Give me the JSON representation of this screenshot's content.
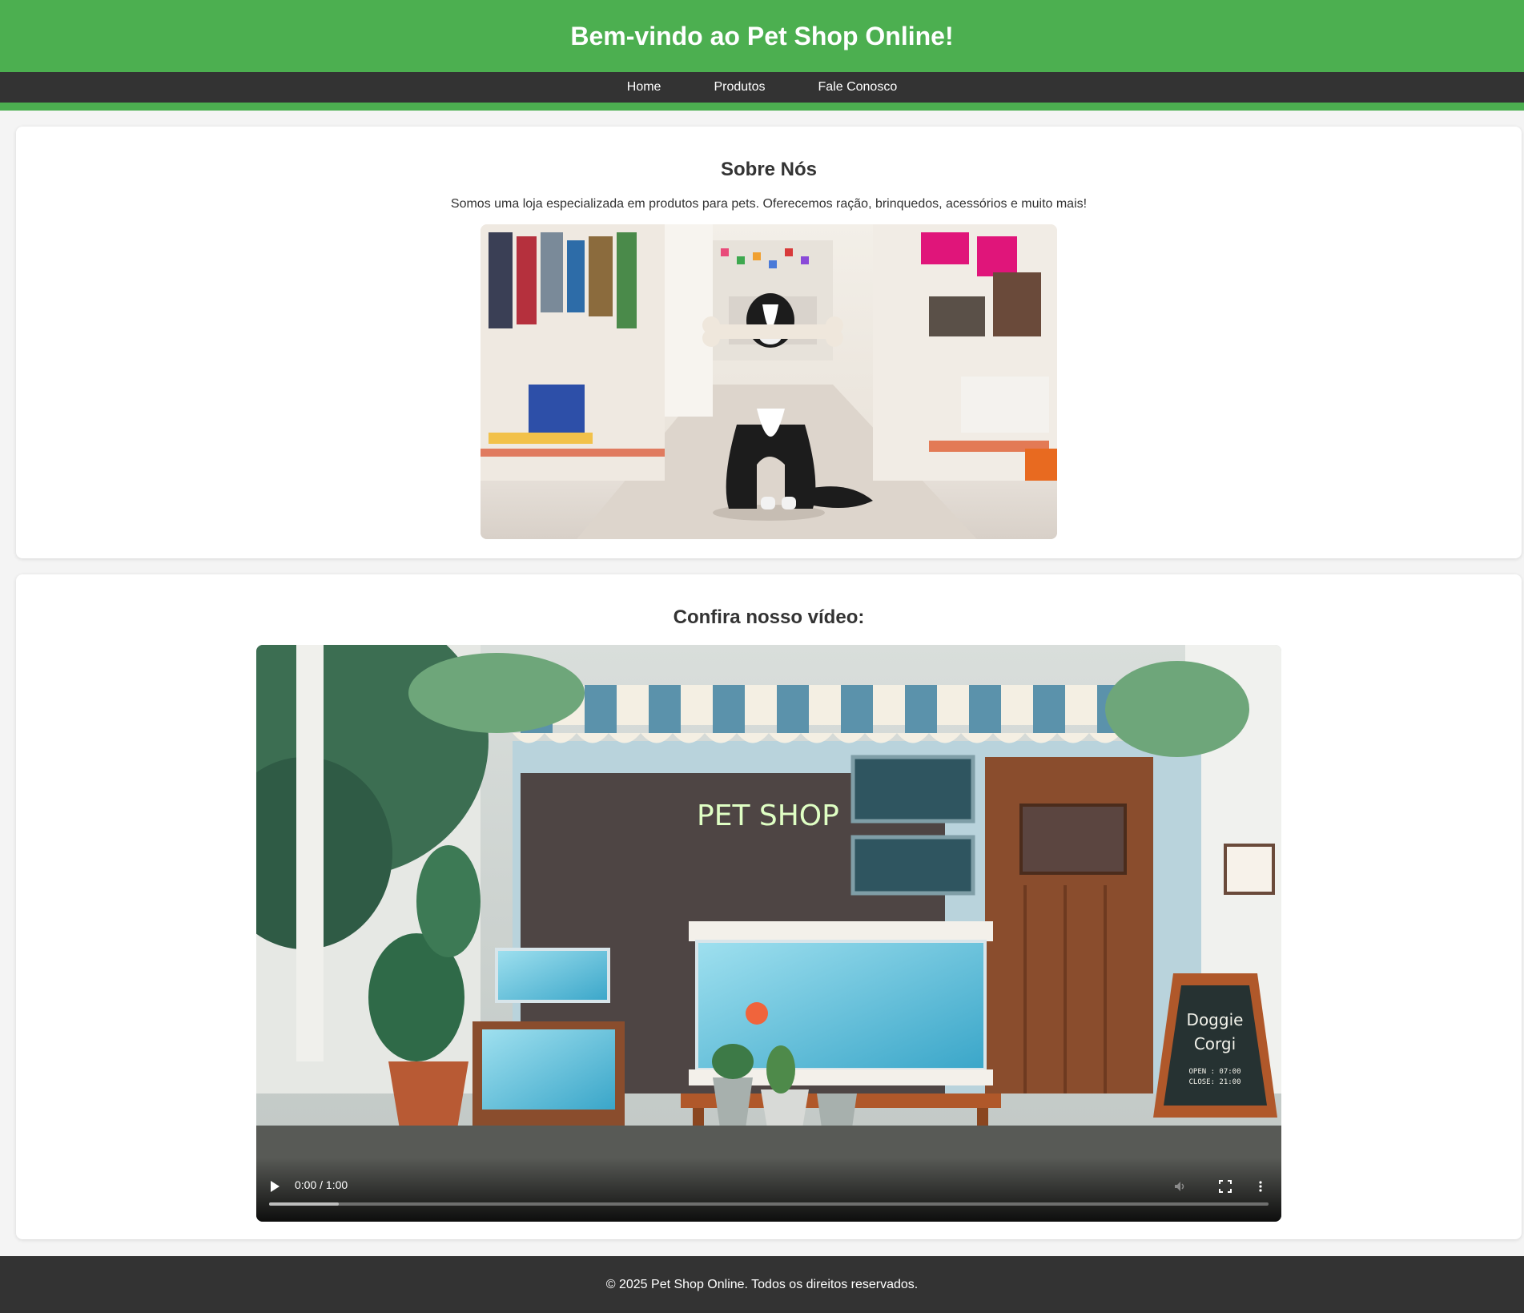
{
  "header": {
    "title": "Bem-vindo ao Pet Shop Online!"
  },
  "nav": {
    "items": [
      {
        "label": "Home"
      },
      {
        "label": "Produtos"
      },
      {
        "label": "Fale Conosco"
      }
    ]
  },
  "about": {
    "heading": "Sobre Nós",
    "text": "Somos uma loja especializada em produtos para pets. Oferecemos ração, brinquedos, acessórios e muito mais!"
  },
  "video_section": {
    "heading": "Confira nosso vídeo:",
    "sign_text": "PET SHOP",
    "board_line1": "Doggie",
    "board_line2": "Corgi",
    "board_open": "OPEN : 07:00",
    "board_close": "CLOSE: 21:00",
    "time": "0:00 / 1:00",
    "buffered_fraction": 0.07
  },
  "footer": {
    "text": "© 2025 Pet Shop Online. Todos os direitos reservados."
  },
  "colors": {
    "brand_green": "#4caf50",
    "dark": "#333333",
    "background": "#f4f4f4"
  },
  "icons": [
    "play-icon",
    "volume-icon",
    "fullscreen-icon",
    "more-options-icon"
  ]
}
